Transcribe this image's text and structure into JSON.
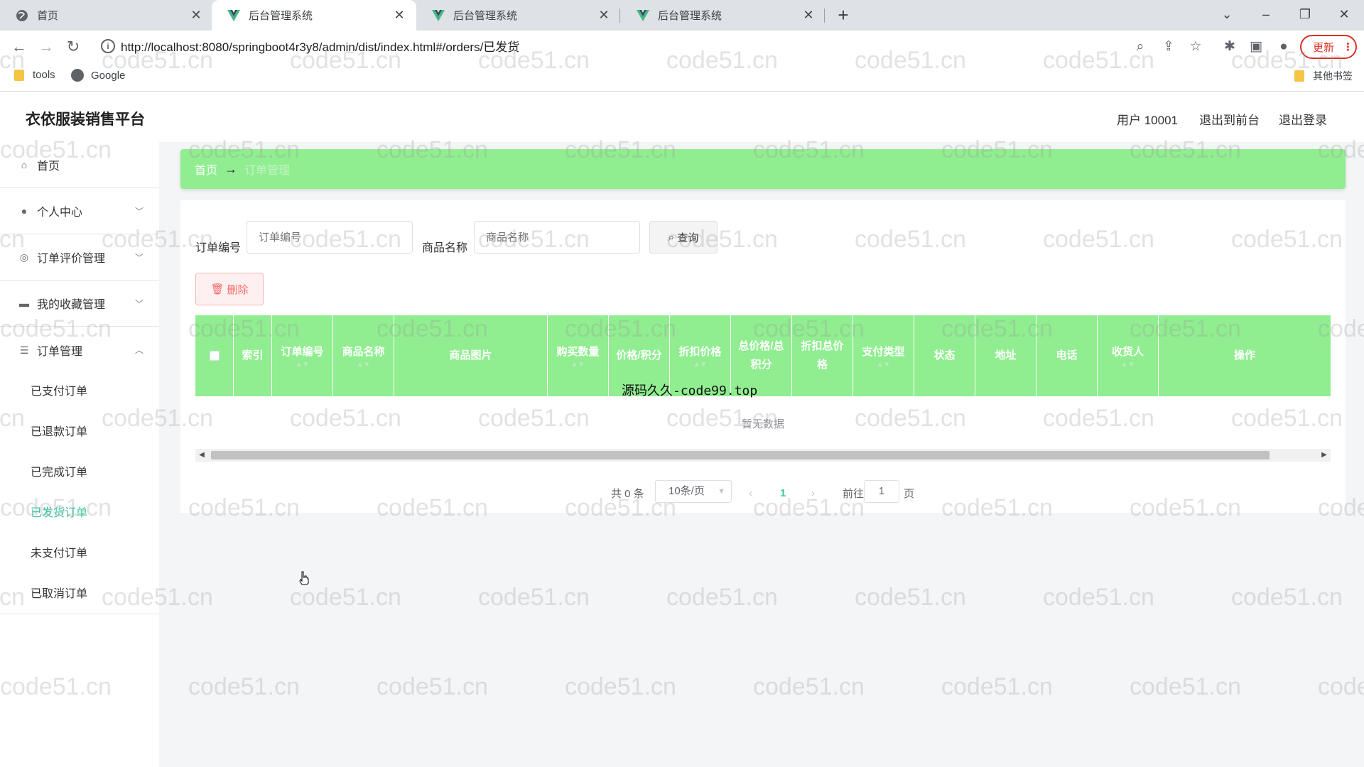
{
  "browser": {
    "tabs": [
      {
        "title": "首页",
        "icon": "globe-icon"
      },
      {
        "title": "后台管理系统",
        "icon": "vue-icon"
      },
      {
        "title": "后台管理系统",
        "icon": "vue-icon"
      },
      {
        "title": "后台管理系统",
        "icon": "vue-icon"
      }
    ],
    "url": "http://localhost:8080/springboot4r3y8/admin/dist/index.html#/orders/已发货",
    "update_label": "更新",
    "bookmarks": [
      {
        "label": "tools",
        "icon": "folder-icon"
      },
      {
        "label": "Google",
        "icon": "globe-icon"
      }
    ],
    "other_bookmarks": "其他书签"
  },
  "app": {
    "title": "衣依服装销售平台",
    "user_label": "用户 10001",
    "to_front_label": "退出到前台",
    "logout_label": "退出登录"
  },
  "sidebar": {
    "items": [
      {
        "label": "首页",
        "icon": "home-icon"
      },
      {
        "label": "个人中心",
        "icon": "user-icon"
      },
      {
        "label": "订单评价管理",
        "icon": "comment-icon"
      },
      {
        "label": "我的收藏管理",
        "icon": "monitor-icon"
      },
      {
        "label": "订单管理",
        "icon": "sliders-icon"
      }
    ],
    "order_submenu": [
      "已支付订单",
      "已退款订单",
      "已完成订单",
      "已发货订单",
      "未支付订单",
      "已取消订单"
    ],
    "active_submenu": "已发货订单"
  },
  "breadcrumb": {
    "home": "首页",
    "arrow": "→",
    "current": "订单管理"
  },
  "search": {
    "order_no_label": "订单编号",
    "order_no_placeholder": "订单编号",
    "product_name_label": "商品名称",
    "product_name_placeholder": "商品名称",
    "query_label": "查询",
    "delete_label": "删除"
  },
  "table": {
    "columns": [
      "索引",
      "订单编号",
      "商品名称",
      "商品图片",
      "购买数量",
      "价格/积分",
      "折扣价格",
      "总价格/总积分",
      "折扣总价格",
      "支付类型",
      "状态",
      "地址",
      "电话",
      "收货人",
      "操作"
    ],
    "empty_text": "暂无数据"
  },
  "pagination": {
    "total": "共 0 条",
    "page_size": "10条/页",
    "current_page": "1",
    "goto_label": "前往",
    "goto_value": "1",
    "page_suffix": "页"
  },
  "overlay_text": "源码久久-code99.top",
  "watermark": "code51.cn",
  "colors": {
    "accent_green": "#90ee90",
    "active_menu": "#3bc4a0",
    "danger": "#f56c6c"
  }
}
